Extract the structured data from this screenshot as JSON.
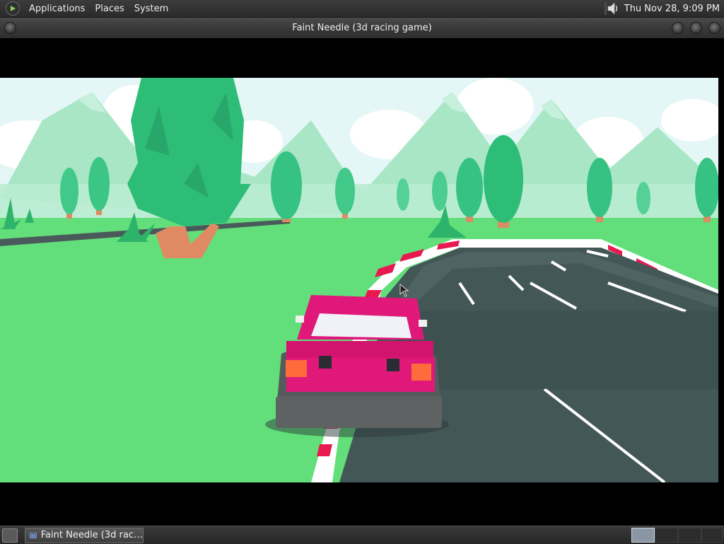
{
  "top_panel": {
    "menus": [
      "Applications",
      "Places",
      "System"
    ],
    "clock": "Thu Nov 28,  9:09 PM",
    "icons": [
      "distro-logo-icon",
      "volume-icon"
    ]
  },
  "window": {
    "title": "Faint Needle (3d racing game)"
  },
  "taskbar": {
    "item_label": "Faint Needle (3d rac…",
    "workspace_count": 4,
    "active_workspace": 1
  },
  "colors": {
    "sky": "#e4f6f6",
    "grass": "#62de7a",
    "road": "#445757",
    "car_body": "#e0187a",
    "curb_red": "#e8194f",
    "tree": "#2dbd77"
  }
}
